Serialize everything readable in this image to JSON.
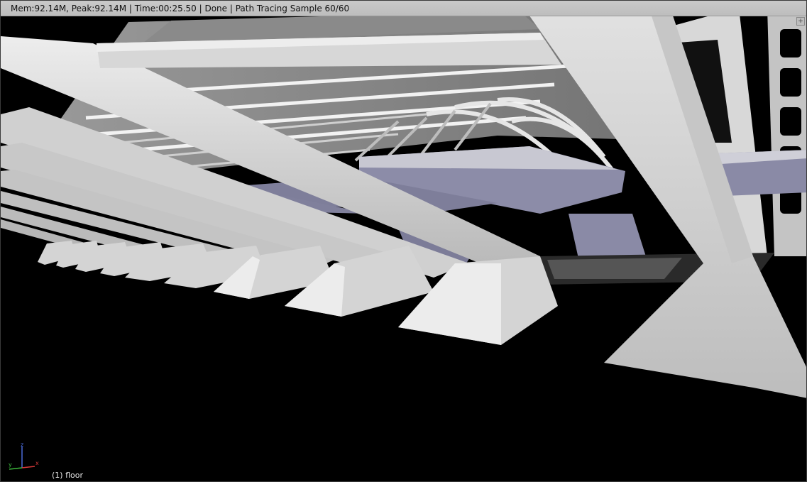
{
  "status": {
    "text": "Mem:92.14M, Peak:92.14M | Time:00:25.50 | Done | Path Tracing Sample 60/60"
  },
  "viewport": {
    "object_label": "(1) floor",
    "axes": {
      "x": "x",
      "y": "y",
      "z": "z"
    },
    "colors": {
      "background": "#000000",
      "structure": "#d6d6d6",
      "slab": "#8c8ca8",
      "x_axis": "#d83a3a",
      "y_axis": "#3cb83c",
      "z_axis": "#4a6ad8"
    }
  },
  "icons": {
    "corner_widget": "plus-icon"
  }
}
